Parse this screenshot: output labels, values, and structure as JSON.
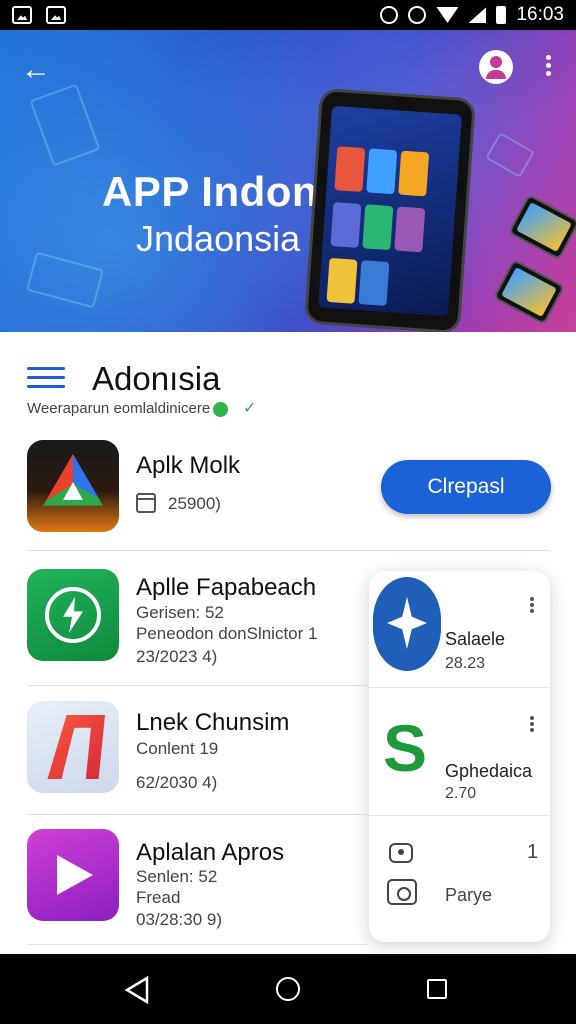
{
  "status_bar": {
    "time": "16:03",
    "left_icons": [
      "gallery-icon",
      "image-icon"
    ],
    "right_icons": [
      "alarm-icon",
      "vibrate-icon",
      "wifi-icon",
      "signal-icon",
      "battery-icon"
    ]
  },
  "banner": {
    "title": "APP Indonsia",
    "subtitle": "Jndaonsia",
    "colors": {
      "start": "#1f6fd8",
      "end": "#c8409a"
    }
  },
  "section": {
    "title": "Adonısia",
    "subtitle": "Weeraparun eomlaldinicere",
    "check": "✓"
  },
  "apps": [
    {
      "title": "Aplk Molk",
      "meta": "25900)",
      "button": "Clrepasl"
    },
    {
      "title": "Aplle Fapabeach",
      "meta1": "Gerisen: 52",
      "meta2": "Peneodon donSlnictor 1",
      "meta3": "23/2023 4)"
    },
    {
      "title": "Lnek Chunsim",
      "meta1": "Conlent 19",
      "meta2": "62/2030 4)"
    },
    {
      "title": "Aplalan Apros",
      "meta1": "Senlen: 52",
      "meta2": "Fread",
      "meta3": "03/28:30 9)"
    }
  ],
  "float_card": {
    "items": [
      {
        "title": "Salaele",
        "sub": "28.23"
      },
      {
        "title": "Gphedaica",
        "sub": "2.70"
      }
    ],
    "row_value": "1",
    "bottom_label": "Parye"
  },
  "colors": {
    "accent": "#1b62d8",
    "verified": "#2fb34a"
  }
}
